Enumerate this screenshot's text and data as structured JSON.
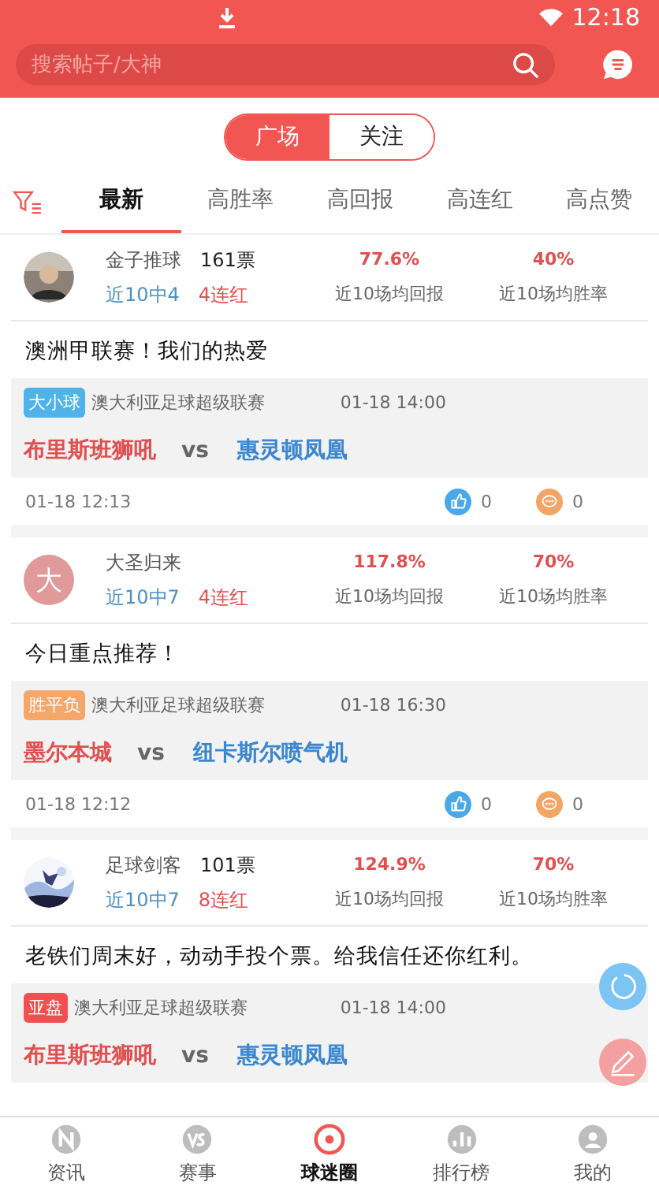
{
  "status_bar": {
    "time": "12:18"
  },
  "search": {
    "placeholder": "搜索帖子/大神"
  },
  "segments": [
    {
      "label": "广场",
      "selected": true
    },
    {
      "label": "关注",
      "selected": false
    }
  ],
  "tabs": [
    {
      "label": "最新",
      "selected": true
    },
    {
      "label": "高胜率",
      "selected": false
    },
    {
      "label": "高回报",
      "selected": false
    },
    {
      "label": "高连红",
      "selected": false
    },
    {
      "label": "高点赞",
      "selected": false
    }
  ],
  "posts": [
    {
      "avatar": {
        "kind": "person"
      },
      "name": "金子推球",
      "votes": "161票",
      "record": "近10中4",
      "streak": "4连红",
      "return_value": "77.6%",
      "return_label": "近10场均回报",
      "win_value": "40%",
      "win_label": "近10场均胜率",
      "text": "澳洲甲联赛！我们的热爱",
      "match": {
        "tag": "大小球",
        "color": "#4fb3ea",
        "league": "澳大利亚足球超级联赛",
        "time": "01-18 14:00",
        "home": "布里斯班狮吼",
        "vs": "vs",
        "away": "惠灵顿凤凰"
      },
      "footer": {
        "time": "01-18 12:13",
        "likes": "0",
        "comments": "0"
      }
    },
    {
      "avatar": {
        "kind": "letter",
        "letter": "大"
      },
      "name": "大圣归来",
      "record": "近10中7",
      "streak": "4连红",
      "return_value": "117.8%",
      "return_label": "近10场均回报",
      "win_value": "70%",
      "win_label": "近10场均胜率",
      "text": "今日重点推荐！",
      "match": {
        "tag": "胜平负",
        "color": "#f5a76a",
        "league": "澳大利亚足球超级联赛",
        "time": "01-18 16:30",
        "home": "墨尔本城",
        "vs": "vs",
        "away": "纽卡斯尔喷气机"
      },
      "footer": {
        "time": "01-18 12:12",
        "likes": "0",
        "comments": "0"
      }
    },
    {
      "name": "足球剑客",
      "votes": "101票",
      "record": "近10中7",
      "streak": "8连红",
      "return_value": "124.9%",
      "return_label": "近10场均回报",
      "win_value": "70%",
      "win_label": "近10场均胜率",
      "text": "老铁们周末好，动动手投个票。给我信任还你红利。",
      "match": {
        "tag": "亚盘",
        "color": "#f05050",
        "league": "澳大利亚足球超级联赛",
        "time": "01-18 14:00",
        "home": "布里斯班狮吼",
        "vs": "vs",
        "away": "惠灵顿凤凰"
      }
    }
  ],
  "nav": [
    {
      "label": "资讯",
      "kind": "news",
      "selected": false
    },
    {
      "label": "赛事",
      "kind": "versus",
      "selected": false
    },
    {
      "label": "球迷圈",
      "kind": "ball",
      "selected": true
    },
    {
      "label": "排行榜",
      "kind": "ranking",
      "selected": false
    },
    {
      "label": "我的",
      "kind": "profile",
      "selected": false
    }
  ]
}
